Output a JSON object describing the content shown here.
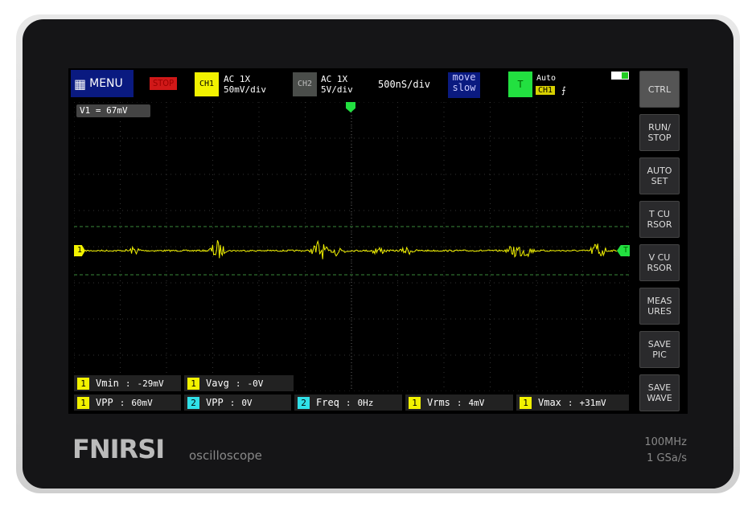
{
  "header": {
    "menu": "MENU",
    "status": "STOP",
    "ch1_label": "CH1",
    "ch1_coupling": "AC  1X",
    "ch1_scale": "50mV/div",
    "ch2_label": "CH2",
    "ch2_coupling": "AC  1X",
    "ch2_scale": "5V/div",
    "timebase": "500nS/div",
    "move_line1": "move",
    "move_line2": "slow",
    "trigger_label": "T",
    "trigger_mode": "Auto",
    "trigger_source": "CH1",
    "trigger_edge": "⨍"
  },
  "cursor_readout": "V1 = 67mV",
  "markers": {
    "ch1": "1",
    "trigger": "T"
  },
  "buttons": [
    {
      "label": "CTRL"
    },
    {
      "label": "RUN/\nSTOP"
    },
    {
      "label": "AUTO\nSET"
    },
    {
      "label": "T CU\nRSOR"
    },
    {
      "label": "V CU\nRSOR"
    },
    {
      "label": "MEAS\nURES"
    },
    {
      "label": "SAVE\nPIC"
    },
    {
      "label": "SAVE\nWAVE"
    }
  ],
  "measurements_row1": [
    {
      "ch": "1",
      "label": "Vmin",
      "value": "-29mV"
    },
    {
      "ch": "1",
      "label": "Vavg",
      "value": "-0V"
    }
  ],
  "measurements_row2": [
    {
      "ch": "1",
      "label": "VPP",
      "value": "60mV"
    },
    {
      "ch": "2",
      "label": "VPP",
      "value": "0V"
    },
    {
      "ch": "2",
      "label": "Freq",
      "value": "0Hz"
    },
    {
      "ch": "1",
      "label": "Vrms",
      "value": "4mV"
    },
    {
      "ch": "1",
      "label": "Vmax",
      "value": "+31mV"
    }
  ],
  "branding": {
    "brand": "FNIRSI",
    "product": "oscilloscope",
    "bandwidth": "100MHz",
    "sample_rate": "1  GSa/s"
  },
  "colors": {
    "ch1": "#f2f200",
    "ch2": "#30e0e8",
    "trigger": "#22e040",
    "menu": "#0a1a80",
    "stop": "#d01818"
  }
}
